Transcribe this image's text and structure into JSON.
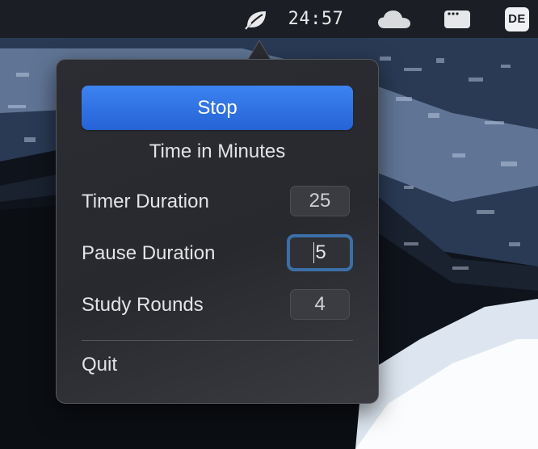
{
  "menubar": {
    "clock": "24:57",
    "input_source": "DE",
    "icons": [
      "leaf-icon",
      "cloud-icon",
      "app-window-icon"
    ]
  },
  "popover": {
    "stop_label": "Stop",
    "section_title": "Time in Minutes",
    "rows": [
      {
        "label": "Timer Duration",
        "value": "25"
      },
      {
        "label": "Pause Duration",
        "value": "5"
      },
      {
        "label": "Study Rounds",
        "value": "4"
      }
    ],
    "quit_label": "Quit"
  },
  "colors": {
    "accent": "#2f6fe0",
    "focus_ring": "#3c6fa8",
    "menubar": "#1b1e24",
    "popover_bg": "#2b2d33"
  }
}
